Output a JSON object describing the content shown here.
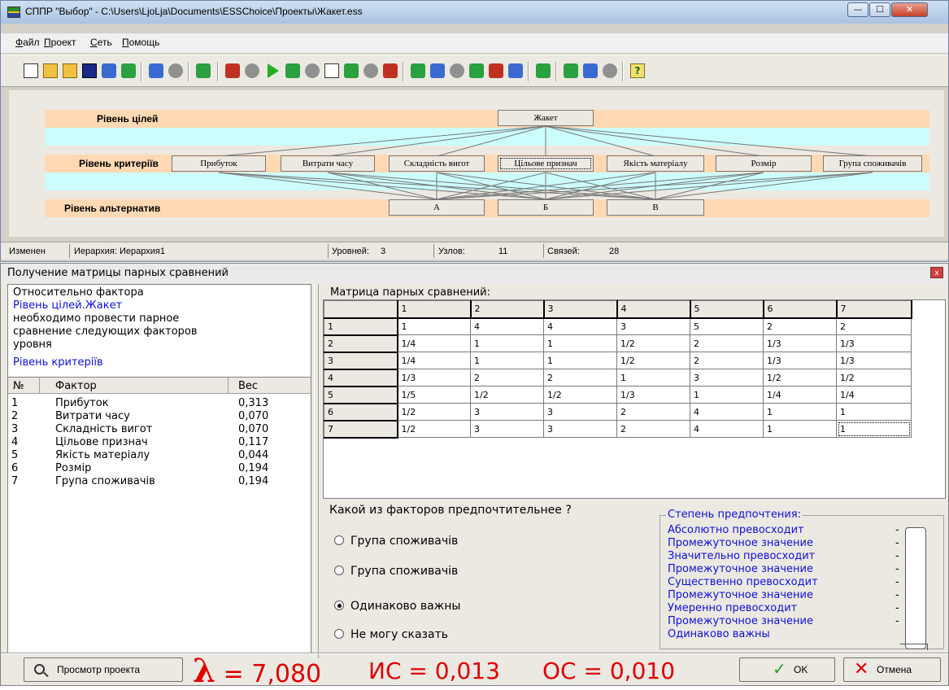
{
  "window": {
    "title": "СППР \"Выбор\" - C:\\Users\\LjoLja\\Documents\\ESSChoice\\Проекты\\Жакет.ess",
    "controls": {
      "minimize": "—",
      "maximize": "☐",
      "close": "✕"
    }
  },
  "menu": {
    "items": [
      "Файл",
      "Проект",
      "Сеть",
      "Помощь"
    ],
    "accels": [
      "Ф",
      "П",
      "С",
      "П"
    ],
    "rests": [
      "айл",
      "роект",
      "еть",
      "омощь"
    ]
  },
  "toolbar": {
    "help_icon": "?"
  },
  "hierarchy": {
    "levels": [
      "Рівень цілей",
      "Рівень критеріїв",
      "Рівень альтернатив"
    ],
    "goal": "Жакет",
    "criteria": [
      "Прибуток",
      "Витрати часу",
      "Складність вигот",
      "Цільове признач",
      "Якість матеріалу",
      "Розмір",
      "Група споживачів"
    ],
    "alternatives": [
      "А",
      "Б",
      "В"
    ]
  },
  "status": {
    "state": "Изменен",
    "hierarchy": "Иерархия:  Иерархия1",
    "levels_label": "Уровней:",
    "levels_value": "3",
    "nodes_label": "Узлов:",
    "nodes_value": "11",
    "links_label": "Связей:",
    "links_value": "28"
  },
  "dialog": {
    "title": "Получение матрицы парных сравнений",
    "close": "x",
    "intro_line1": "Относительно фактора",
    "factor_ref": "Рівень цілей.Жакет",
    "intro_line2": "необходимо провести парное",
    "intro_line3": "сравнение следующих факторов",
    "intro_line4": "уровня",
    "level_ref": "Рівень критеріїв",
    "factor_table": {
      "headers": [
        "№",
        "Фактор",
        "Вес"
      ],
      "rows": [
        [
          "1",
          "Прибуток",
          "0,313"
        ],
        [
          "2",
          "Витрати часу",
          "0,070"
        ],
        [
          "3",
          "Складність вигот",
          "0,070"
        ],
        [
          "4",
          "Цільове признач",
          "0,117"
        ],
        [
          "5",
          "Якість матеріалу",
          "0,044"
        ],
        [
          "6",
          "Розмір",
          "0,194"
        ],
        [
          "7",
          "Група споживачів",
          "0,194"
        ]
      ]
    },
    "matrix_label": "Матрица парных сравнений:",
    "matrix": {
      "col_headers": [
        "1",
        "2",
        "3",
        "4",
        "5",
        "6",
        "7"
      ],
      "row_headers": [
        "1",
        "2",
        "3",
        "4",
        "5",
        "6",
        "7"
      ],
      "cells": [
        [
          "1",
          "4",
          "4",
          "3",
          "5",
          "2",
          "2"
        ],
        [
          "1/4",
          "1",
          "1",
          "1/2",
          "2",
          "1/3",
          "1/3"
        ],
        [
          "1/4",
          "1",
          "1",
          "1/2",
          "2",
          "1/3",
          "1/3"
        ],
        [
          "1/3",
          "2",
          "2",
          "1",
          "3",
          "1/2",
          "1/2"
        ],
        [
          "1/5",
          "1/2",
          "1/2",
          "1/3",
          "1",
          "1/4",
          "1/4"
        ],
        [
          "1/2",
          "3",
          "3",
          "2",
          "4",
          "1",
          "1"
        ],
        [
          "1/2",
          "3",
          "3",
          "2",
          "4",
          "1",
          "1"
        ]
      ]
    },
    "question": "Какой из факторов предпочтительнее ?",
    "options": [
      "Група споживачів",
      "Група споживачів",
      "Одинаково важны",
      "Не могу сказать"
    ],
    "selected_option": 2,
    "preference_legend": "Степень предпочтения:",
    "preference_levels": [
      "Абсолютно превосходит",
      "Промежуточное значение",
      "Значительно превосходит",
      "Промежуточное значение",
      "Существенно превосходит",
      "Промежуточное значение",
      "Умеренно превосходит",
      "Промежуточное значение",
      "Одинаково важны"
    ],
    "view_project_label": "Просмотр проекта",
    "lambda_symbol": "λ",
    "lambda_text": " = 7,080",
    "ci_text": "ИС = 0,013",
    "cr_text": "ОС = 0,010",
    "ok_label": "OK",
    "cancel_label": "Отмена"
  }
}
